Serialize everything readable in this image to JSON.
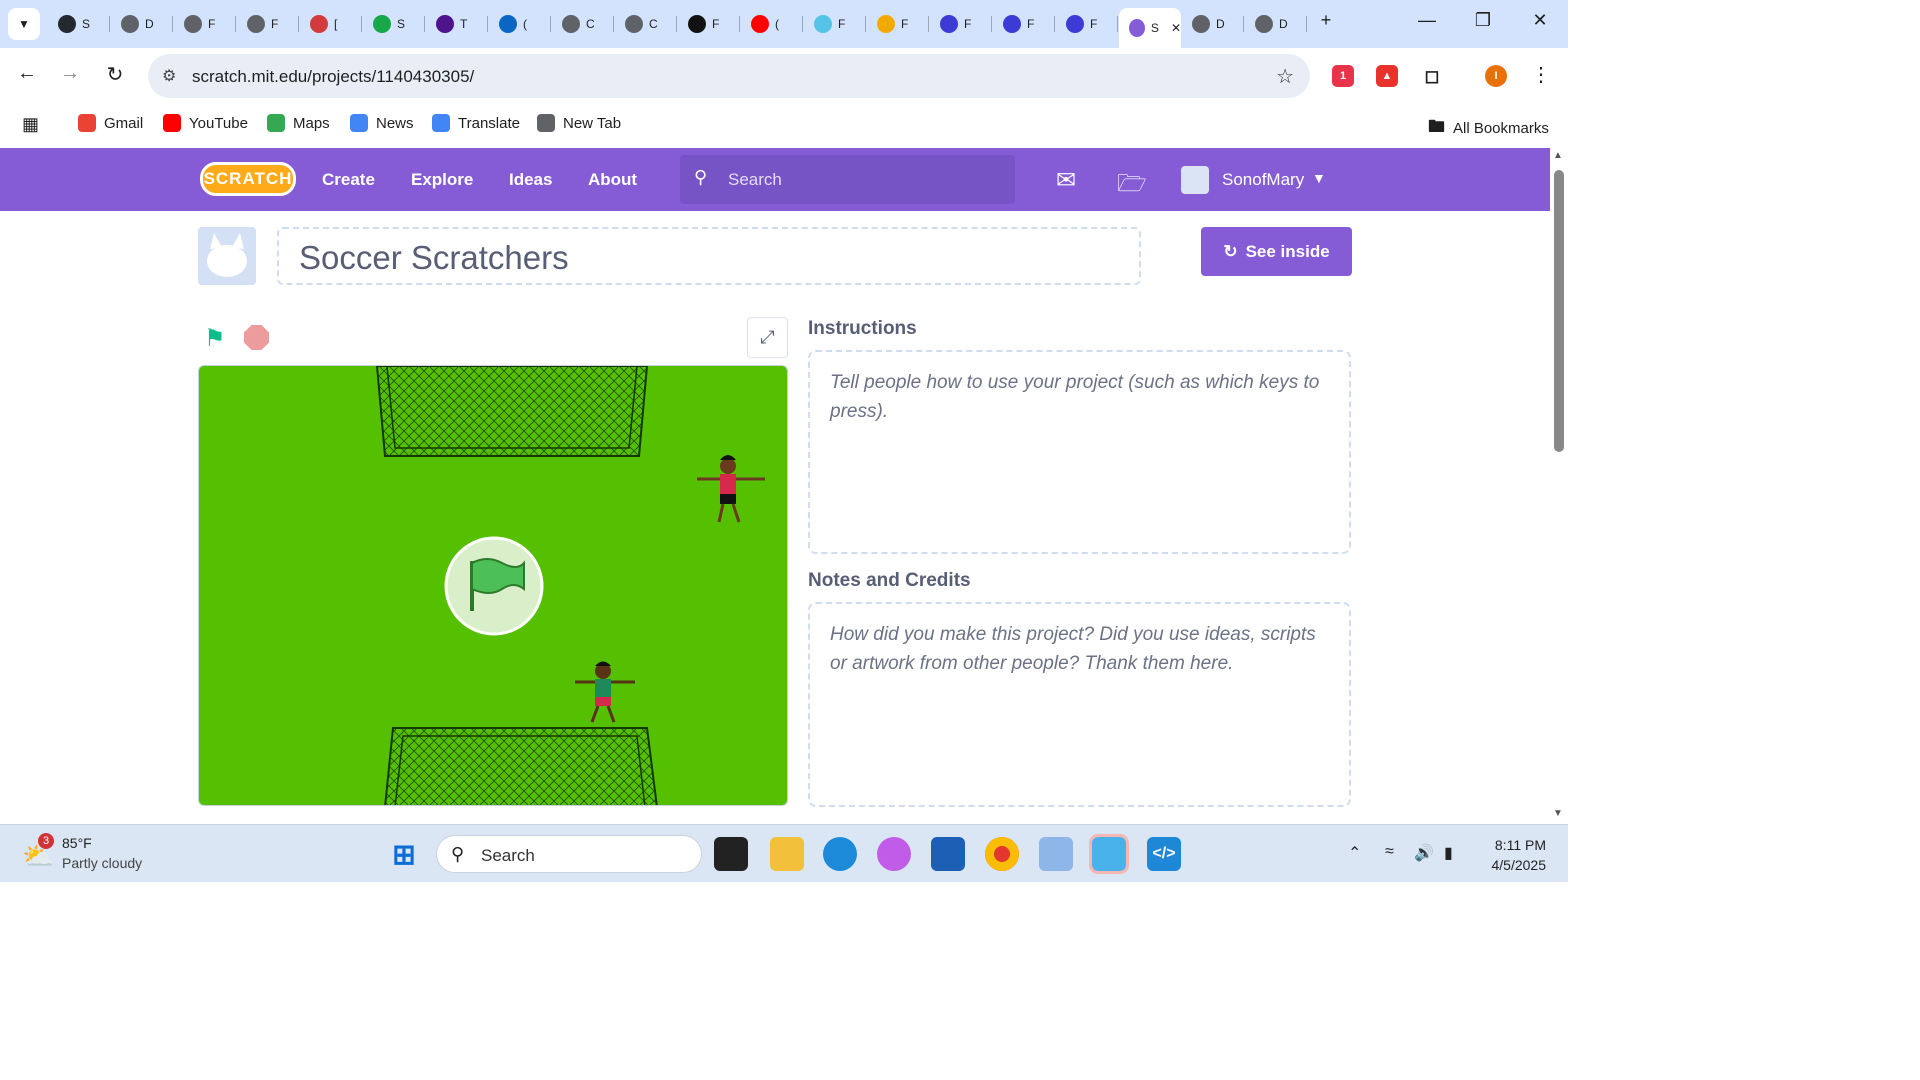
{
  "browser": {
    "tabs": [
      {
        "icon": "github-icon",
        "label": "S"
      },
      {
        "icon": "globe-icon",
        "label": "D"
      },
      {
        "icon": "globe-icon",
        "label": "F"
      },
      {
        "icon": "globe-icon",
        "label": "F"
      },
      {
        "icon": "book-icon",
        "label": "["
      },
      {
        "icon": "green-app-icon",
        "label": "S"
      },
      {
        "icon": "fedex-icon",
        "label": "T"
      },
      {
        "icon": "linkedin-icon",
        "label": "("
      },
      {
        "icon": "globe-icon",
        "label": "C"
      },
      {
        "icon": "globe-icon",
        "label": "C"
      },
      {
        "icon": "amazon-icon",
        "label": "F"
      },
      {
        "icon": "youtube-icon",
        "label": "("
      },
      {
        "icon": "flo-icon",
        "label": "F"
      },
      {
        "icon": "scholar-icon",
        "label": "F"
      },
      {
        "icon": "app-icon",
        "label": "F"
      },
      {
        "icon": "app-icon",
        "label": "F"
      },
      {
        "icon": "app-icon",
        "label": "F"
      },
      {
        "icon": "scratch-icon",
        "label": "S",
        "active": true
      },
      {
        "icon": "globe-icon",
        "label": "D"
      },
      {
        "icon": "globe-icon",
        "label": "D"
      }
    ],
    "url": "scratch.mit.edu/projects/1140430305/",
    "bookmarks": [
      {
        "icon": "gmail-icon",
        "label": "Gmail"
      },
      {
        "icon": "youtube-icon",
        "label": "YouTube"
      },
      {
        "icon": "maps-icon",
        "label": "Maps"
      },
      {
        "icon": "news-icon",
        "label": "News"
      },
      {
        "icon": "translate-icon",
        "label": "Translate"
      },
      {
        "icon": "globe-icon",
        "label": "New Tab"
      }
    ],
    "all_bookmarks": "All Bookmarks",
    "profile_initial": "I",
    "extension_badge": "1"
  },
  "scratch": {
    "logo": "SCRATCH",
    "nav": {
      "create": "Create",
      "explore": "Explore",
      "ideas": "Ideas",
      "about": "About",
      "search_placeholder": "Search",
      "username": "SonofMary"
    },
    "project": {
      "title": "Soccer Scratchers",
      "see_inside": "See inside",
      "instructions_heading": "Instructions",
      "instructions_placeholder": "Tell people how to use your project (such as which keys to press).",
      "notes_heading": "Notes and Credits",
      "notes_placeholder": "How did you make this project? Did you use ideas, scripts or artwork from other people? Thank them here."
    },
    "colors": {
      "brand": "#855cd6",
      "stage_grass": "#54c000"
    }
  },
  "taskbar": {
    "weather_temp": "85°F",
    "weather_cond": "Partly cloudy",
    "weather_badge": "3",
    "search_placeholder": "Search",
    "time": "8:11 PM",
    "date": "4/5/2025"
  }
}
